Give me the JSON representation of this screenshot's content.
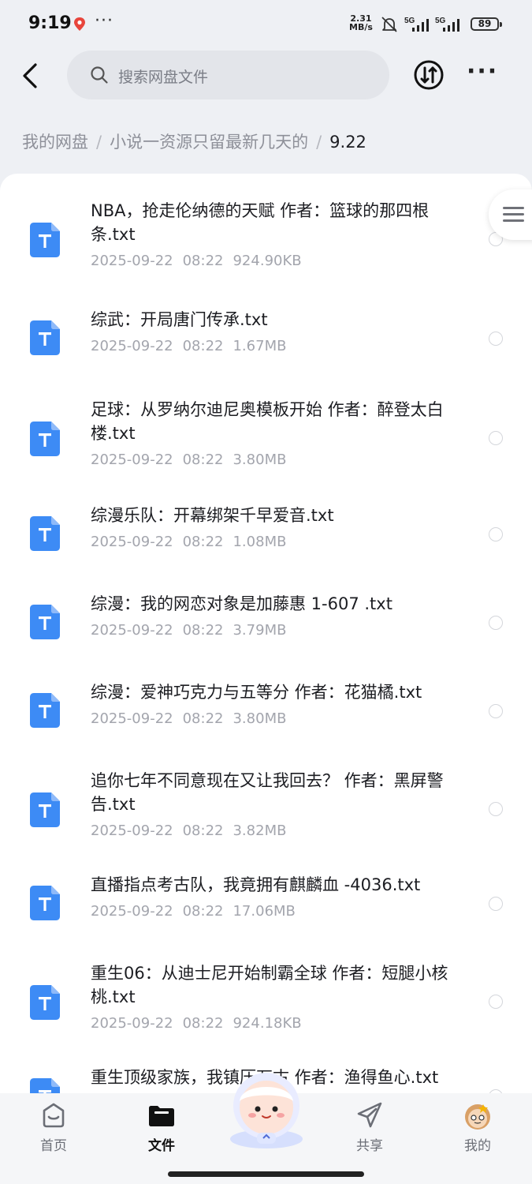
{
  "status_bar": {
    "time": "9:19",
    "more_dots": "···",
    "net_speed_value": "2.31",
    "net_speed_unit": "MB/s",
    "signal_1": "5G",
    "signal_2": "5G",
    "battery": "89"
  },
  "header": {
    "search_placeholder": "搜索网盘文件",
    "more_label": "···"
  },
  "breadcrumb": {
    "items": [
      "我的网盘",
      "小说一资源只留最新几天的"
    ],
    "current": "9.22",
    "separator": "/"
  },
  "files": [
    {
      "name": "NBA，抢走伦纳德的天赋 作者：篮球的那四根条.txt",
      "date": "2025-09-22",
      "time": "08:22",
      "size": "924.90KB",
      "icon": "txt-file-icon"
    },
    {
      "name": "综武：开局唐门传承.txt",
      "date": "2025-09-22",
      "time": "08:22",
      "size": "1.67MB",
      "icon": "txt-file-icon"
    },
    {
      "name": "足球：从罗纳尔迪尼奥模板开始 作者：醉登太白楼.txt",
      "date": "2025-09-22",
      "time": "08:22",
      "size": "3.80MB",
      "icon": "txt-file-icon"
    },
    {
      "name": "综漫乐队：开幕绑架千早爱音.txt",
      "date": "2025-09-22",
      "time": "08:22",
      "size": "1.08MB",
      "icon": "txt-file-icon"
    },
    {
      "name": "综漫：我的网恋对象是加藤惠 1-607  .txt",
      "date": "2025-09-22",
      "time": "08:22",
      "size": "3.79MB",
      "icon": "txt-file-icon"
    },
    {
      "name": "综漫：爱神巧克力与五等分 作者：花猫橘.txt",
      "date": "2025-09-22",
      "time": "08:22",
      "size": "3.80MB",
      "icon": "txt-file-icon"
    },
    {
      "name": "追你七年不同意现在又让我回去？ 作者：黑屏警告.txt",
      "date": "2025-09-22",
      "time": "08:22",
      "size": "3.82MB",
      "icon": "txt-file-icon"
    },
    {
      "name": "直播指点考古队，我竟拥有麒麟血 -4036.txt",
      "date": "2025-09-22",
      "time": "08:22",
      "size": "17.06MB",
      "icon": "txt-file-icon"
    },
    {
      "name": "重生06：从迪士尼开始制霸全球 作者：短腿小核桃.txt",
      "date": "2025-09-22",
      "time": "08:22",
      "size": "924.18KB",
      "icon": "txt-file-icon"
    },
    {
      "name": "重生顶级家族，我镇压万古 作者：渔得鱼心.txt",
      "date": "",
      "time": "",
      "size": "",
      "icon": "txt-file-icon"
    }
  ],
  "bottom_nav": {
    "items": [
      {
        "label": "首页",
        "icon": "home-icon",
        "active": false
      },
      {
        "label": "文件",
        "icon": "folder-icon",
        "active": true
      },
      {
        "label": "共享",
        "icon": "share-icon",
        "active": false
      },
      {
        "label": "我的",
        "icon": "profile-avatar-icon",
        "active": false
      }
    ]
  },
  "colors": {
    "accent_blue": "#3d8bf5",
    "background": "#eef0f4",
    "text_primary": "#1c1d22",
    "text_secondary": "#a3a5ad"
  }
}
